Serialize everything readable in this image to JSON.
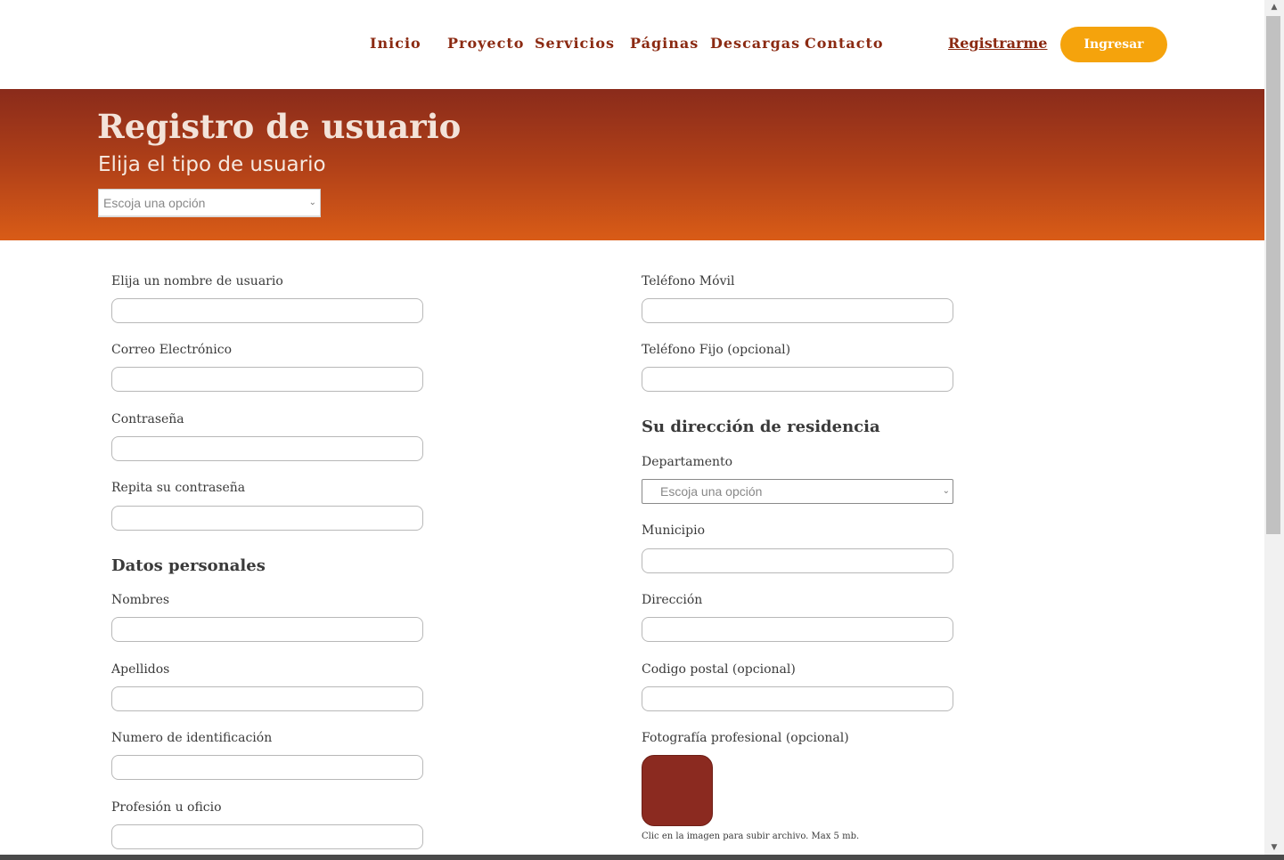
{
  "nav": {
    "items": [
      "Inicio",
      "Proyecto",
      "Servicios",
      "Páginas",
      "Descargas",
      "Contacto"
    ],
    "register": "Registrarme",
    "login": "Ingresar"
  },
  "banner": {
    "title": "Registro de usuario",
    "subtitle": "Elija el tipo de usuario",
    "select_value": "Escoja una opción"
  },
  "form": {
    "left": {
      "username_label": "Elija un nombre de usuario",
      "email_label": "Correo Electrónico",
      "password_label": "Contraseña",
      "repeat_password_label": "Repita su contraseña",
      "personal_title": "Datos personales",
      "names_label": "Nombres",
      "lastnames_label": "Apellidos",
      "id_label": "Numero de identificación",
      "profession_label": "Profesión u oficio"
    },
    "right": {
      "mobile_label": "Teléfono Móvil",
      "landline_label": "Teléfono Fijo (opcional)",
      "address_title": "Su dirección de residencia",
      "department_label": "Departamento",
      "department_value": "Escoja una opción",
      "municipality_label": "Municipio",
      "address_label": "Dirección",
      "postal_label": "Codigo postal (opcional)",
      "photo_label": "Fotografía profesional (opcional)",
      "photo_hint": "Clic en la imagen para subir archivo. Max 5 mb."
    }
  },
  "colors": {
    "brand": "#8b2a12",
    "accent": "#f5a30c",
    "banner_top": "#8a2b1b",
    "banner_bottom": "#d95c17"
  }
}
